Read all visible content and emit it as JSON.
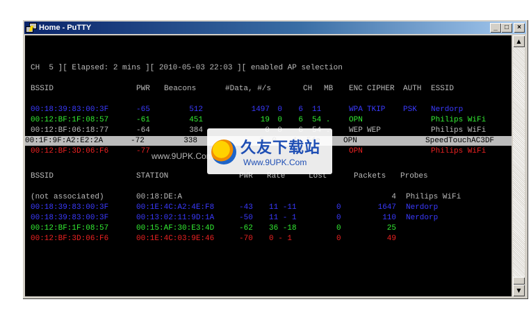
{
  "window": {
    "title": "Home - PuTTY"
  },
  "colors": {
    "blue": "#3a3aff",
    "green": "#33ee33",
    "red": "#ee2222",
    "gray": "#bbbbbb"
  },
  "status_line": "CH  5 ][ Elapsed: 2 mins ][ 2010-05-03 22:03 ][ enabled AP selection",
  "ap_headers": [
    "BSSID",
    "PWR",
    "Beacons",
    "#Data, #/s",
    "CH",
    "MB",
    "ENC",
    "CIPHER",
    "AUTH",
    "ESSID"
  ],
  "aps": [
    {
      "bssid": "00:18:39:83:00:3F",
      "pwr": "-65",
      "beacons": "512",
      "data": "1497",
      "s": "0",
      "ch": "6",
      "mb": "11",
      "enc": "WPA",
      "cipher": "TKIP",
      "auth": "PSK",
      "essid": "Nerdorp",
      "color": "blue"
    },
    {
      "bssid": "00:12:BF:1F:08:57",
      "pwr": "-61",
      "beacons": "451",
      "data": "19",
      "s": "0",
      "ch": "6",
      "mb": "54 .",
      "enc": "OPN",
      "cipher": "",
      "auth": "",
      "essid": "Philips WiFi",
      "color": "green"
    },
    {
      "bssid": "00:12:BF:06:18:77",
      "pwr": "-64",
      "beacons": "384",
      "data": "0",
      "s": "0",
      "ch": "6",
      "mb": "54 .",
      "enc": "WEP",
      "cipher": "WEP",
      "auth": "",
      "essid": "Philips WiFi",
      "color": "gray"
    },
    {
      "bssid": "00:1F:9F:A2:E2:2A",
      "pwr": "-72",
      "beacons": "338",
      "data": "5",
      "s": "0",
      "ch": "1",
      "mb": "54e",
      "enc": "OPN",
      "cipher": "",
      "auth": "",
      "essid": "SpeedTouchAC3DF",
      "color": "selected"
    },
    {
      "bssid": "00:12:BF:3D:06:F6",
      "pwr": "-77",
      "beacons": "",
      "data": "",
      "s": "",
      "ch": "",
      "mb": "",
      "enc": "OPN",
      "cipher": "",
      "auth": "",
      "essid": "Philips WiFi",
      "color": "red"
    }
  ],
  "station_headers": [
    "BSSID",
    "STATION",
    "PWR",
    "Rate",
    "Lost",
    "Packets",
    "Probes"
  ],
  "stations": [
    {
      "bssid": "(not associated)",
      "station": "00:18:DE:A",
      "pwr": "",
      "rate": "",
      "lost": "",
      "packets": "4",
      "probes": "Philips WiFi",
      "color": "gray"
    },
    {
      "bssid": "00:18:39:83:00:3F",
      "station": "00:1E:4C:A2:4E:F8",
      "pwr": "-43",
      "rate": "11 -11",
      "lost": "0",
      "packets": "1647",
      "probes": "Nerdorp",
      "color": "blue"
    },
    {
      "bssid": "00:18:39:83:00:3F",
      "station": "00:13:02:11:9D:1A",
      "pwr": "-50",
      "rate": "11 - 1",
      "lost": "0",
      "packets": "110",
      "probes": "Nerdorp",
      "color": "blue"
    },
    {
      "bssid": "00:12:BF:1F:08:57",
      "station": "00:15:AF:30:E3:4D",
      "pwr": "-62",
      "rate": "36 -18",
      "lost": "0",
      "packets": "25",
      "probes": "",
      "color": "green"
    },
    {
      "bssid": "00:12:BF:3D:06:F6",
      "station": "00:1E:4C:03:9E:46",
      "pwr": "-70",
      "rate": "0 - 1",
      "lost": "0",
      "packets": "49",
      "probes": "",
      "color": "red"
    }
  ],
  "watermark": {
    "title": "久友下载站",
    "url": "Www.9UPK.Com",
    "left_text": "www.9UPK.Com"
  }
}
